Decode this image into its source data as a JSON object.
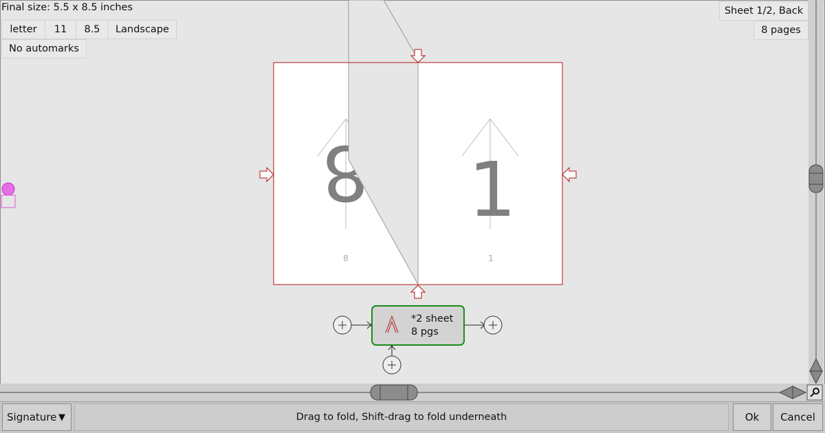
{
  "header": {
    "final_size": "Final size: 5.5 x 8.5 inches",
    "sheet_info": "Sheet 1/2, Back",
    "pages_count": "8 pages"
  },
  "paper": {
    "size_name": "letter",
    "width": "11",
    "height": "8.5",
    "orientation": "Landscape",
    "automarks": "No automarks"
  },
  "pages": {
    "left_number": "8",
    "left_label": "8",
    "right_number": "1",
    "right_label": "1"
  },
  "signature_node": {
    "line1": "*2 sheet",
    "line2": "8 pgs"
  },
  "bottom": {
    "mode_label": "Signature",
    "dropdown_icon": "triangle-down-icon",
    "message": "Drag to fold, Shift-drag to fold underneath",
    "ok_label": "Ok",
    "cancel_label": "Cancel"
  },
  "colors": {
    "crop_red": "#b01818",
    "node_green": "#1a8c1a",
    "marker_magenta": "#e040e0"
  }
}
